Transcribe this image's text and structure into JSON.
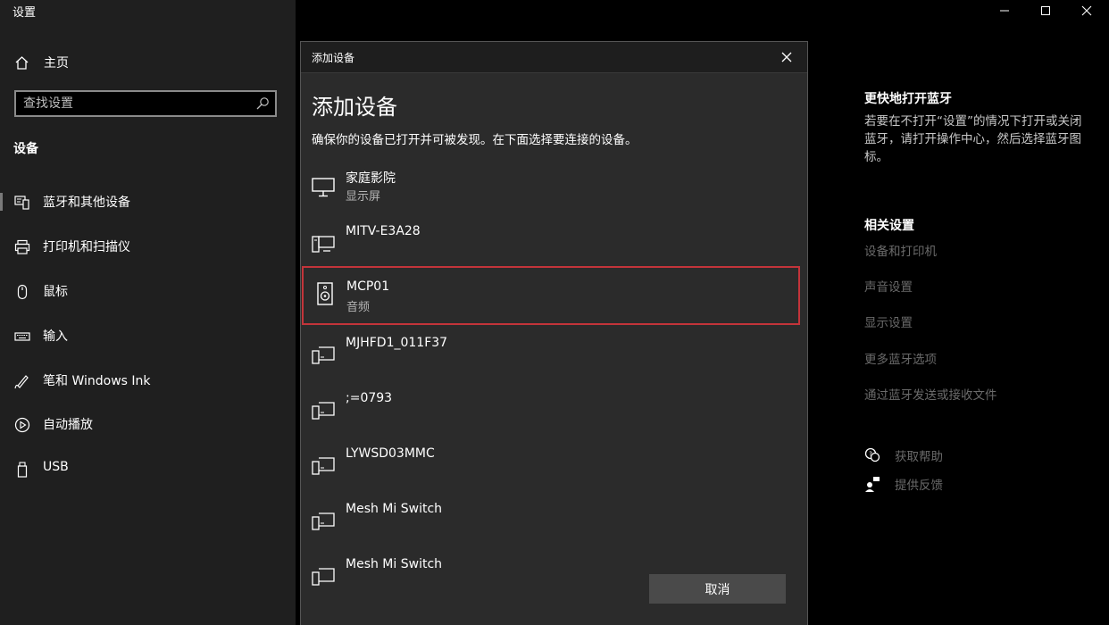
{
  "window": {
    "title": "设置"
  },
  "sidebar": {
    "home_label": "主页",
    "search_placeholder": "查找设置",
    "section_heading": "设备",
    "items": [
      {
        "label": "蓝牙和其他设备",
        "icon": "bluetooth-devices-icon",
        "selected": true
      },
      {
        "label": "打印机和扫描仪",
        "icon": "printer-icon"
      },
      {
        "label": "鼠标",
        "icon": "mouse-icon"
      },
      {
        "label": "输入",
        "icon": "keyboard-icon"
      },
      {
        "label": "笔和 Windows Ink",
        "icon": "pen-icon"
      },
      {
        "label": "自动播放",
        "icon": "autoplay-icon"
      },
      {
        "label": "USB",
        "icon": "usb-icon"
      }
    ]
  },
  "dialog": {
    "titlebar": "添加设备",
    "heading": "添加设备",
    "description": "确保你的设备已打开并可被发现。在下面选择要连接的设备。",
    "devices": [
      {
        "name": "家庭影院",
        "type": "显示屏",
        "icon": "monitor-icon"
      },
      {
        "name": "MITV-E3A28",
        "type": "",
        "icon": "computer-devices-icon"
      },
      {
        "name": "MCP01",
        "type": "音频",
        "icon": "speaker-icon",
        "highlighted": true
      },
      {
        "name": "MJHFD1_011F37",
        "type": "",
        "icon": "generic-device-icon"
      },
      {
        "name": ";=0793",
        "type": "",
        "icon": "generic-device-icon"
      },
      {
        "name": "LYWSD03MMC",
        "type": "",
        "icon": "generic-device-icon"
      },
      {
        "name": "Mesh Mi Switch",
        "type": "",
        "icon": "generic-device-icon"
      },
      {
        "name": "Mesh Mi Switch",
        "type": "",
        "icon": "generic-device-icon"
      }
    ],
    "cancel_label": "取消"
  },
  "right_panel": {
    "bluetooth_title": "更快地打开蓝牙",
    "bluetooth_text": "若要在不打开“设置”的情况下打开或关闭蓝牙，请打开操作中心，然后选择蓝牙图标。",
    "related_title": "相关设置",
    "related_links": [
      "设备和打印机",
      "声音设置",
      "显示设置",
      "更多蓝牙选项",
      "通过蓝牙发送或接收文件"
    ],
    "help_label": "获取帮助",
    "feedback_label": "提供反馈"
  },
  "colors": {
    "highlight_border": "#c3343a",
    "dialog_bg": "#2b2b2b",
    "sidebar_bg": "#1f1f1f"
  }
}
